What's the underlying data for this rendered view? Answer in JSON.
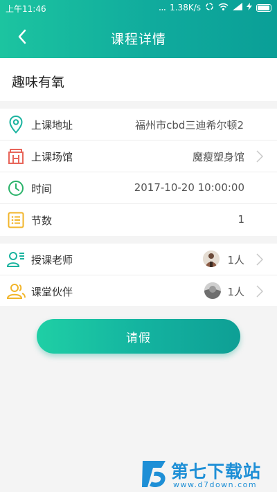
{
  "status_bar": {
    "time": "上午11:46",
    "dots": "...",
    "speed": "1.38K/s"
  },
  "header": {
    "title": "课程详情"
  },
  "course": {
    "name": "趣味有氧"
  },
  "info_rows": [
    {
      "label": "上课地址",
      "value": "福州市cbd三迪希尔顿2",
      "icon": "location-pin-icon",
      "icon_color": "#1ab39f"
    },
    {
      "label": "上课场馆",
      "value": "魔瘦塑身馆",
      "icon": "building-icon",
      "icon_color": "#e8655a"
    },
    {
      "label": "时间",
      "value": "2017-10-20 10:00:00",
      "icon": "clock-icon",
      "icon_color": "#2bb36a"
    },
    {
      "label": "节数",
      "value": "1",
      "icon": "list-icon",
      "icon_color": "#f2b52a"
    }
  ],
  "people_rows": [
    {
      "label": "授课老师",
      "value": "1人",
      "icon": "teacher-icon",
      "icon_color": "#1ab39f"
    },
    {
      "label": "课堂伙伴",
      "value": "1人",
      "icon": "partners-icon",
      "icon_color": "#f2b52a"
    }
  ],
  "actions": {
    "leave_label": "请假"
  },
  "watermark": {
    "title": "第七下载站",
    "url": "www.d7down.com"
  },
  "colors": {
    "header_start": "#1cc4a0",
    "header_end": "#0a9f97",
    "button_start": "#1fcfa5",
    "button_end": "#0e9f95",
    "watermark_blue": "#1e8fd6"
  }
}
